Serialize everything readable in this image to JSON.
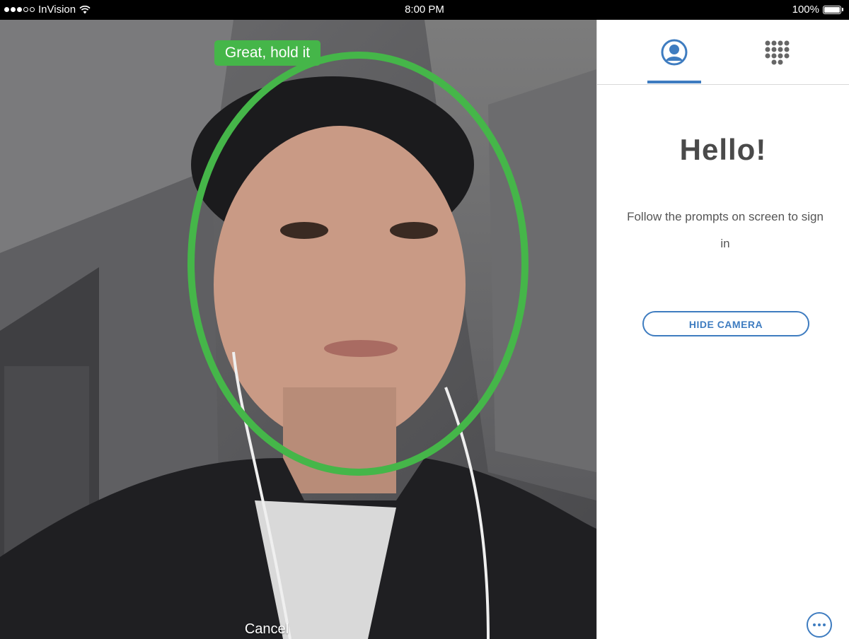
{
  "status_bar": {
    "carrier": "InVision",
    "time": "8:00 PM",
    "battery": "100%",
    "battery_level": 1.0
  },
  "camera": {
    "prompt": "Great, hold it",
    "cancel_label": "Cancel",
    "face_guide_color": "#45b649"
  },
  "panel": {
    "tabs": [
      {
        "icon": "person-icon",
        "active": true
      },
      {
        "icon": "keypad-icon",
        "active": false
      }
    ],
    "greeting": "Hello!",
    "instructions": "Follow the prompts on screen to sign in",
    "hide_camera_label": "HIDE CAMERA",
    "more_icon": "ellipsis-icon",
    "accent_color": "#3e7cc0"
  }
}
